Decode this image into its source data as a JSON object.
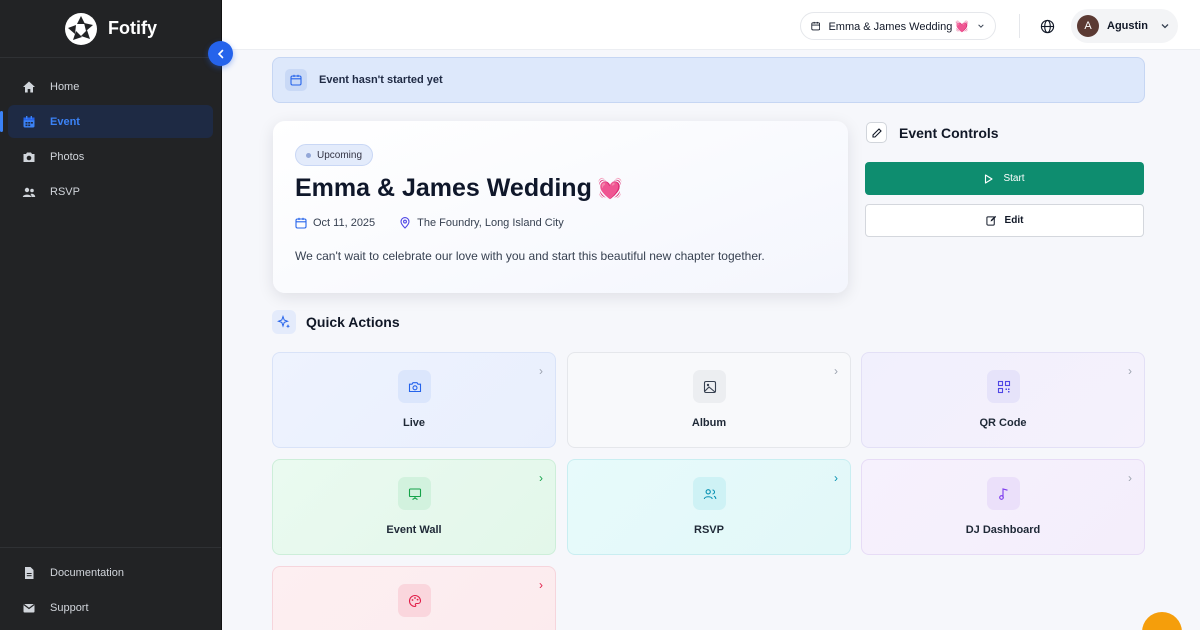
{
  "app": {
    "name": "Fotify"
  },
  "sidebar": {
    "items": [
      {
        "label": "Home",
        "icon": "home-icon"
      },
      {
        "label": "Event",
        "icon": "calendar-icon",
        "active": true
      },
      {
        "label": "Photos",
        "icon": "camera-icon"
      },
      {
        "label": "RSVP",
        "icon": "users-icon"
      }
    ],
    "bottom": [
      {
        "label": "Documentation",
        "icon": "document-icon"
      },
      {
        "label": "Support",
        "icon": "mail-icon"
      }
    ]
  },
  "header": {
    "event_selector": "Emma & James Wedding 💓",
    "user": {
      "initial": "A",
      "name": "Agustin"
    }
  },
  "banner": {
    "text": "Event hasn't started yet"
  },
  "event": {
    "status": "Upcoming",
    "title": "Emma & James Wedding",
    "emoji": "💓",
    "date": "Oct 11, 2025",
    "location": "The Foundry, Long Island City",
    "description": "We can't wait to celebrate our love with you and start this beautiful new chapter together."
  },
  "controls": {
    "title": "Event Controls",
    "start_label": "Start",
    "edit_label": "Edit"
  },
  "quick_actions": {
    "title": "Quick Actions",
    "tiles": [
      {
        "label": "Live",
        "icon": "camera-icon",
        "color": "#2563eb"
      },
      {
        "label": "Album",
        "icon": "image-icon",
        "color": "#374151"
      },
      {
        "label": "QR Code",
        "icon": "qr-code-icon",
        "color": "#4f46e5"
      },
      {
        "label": "Event Wall",
        "icon": "presentation-icon",
        "color": "#16a34a"
      },
      {
        "label": "RSVP",
        "icon": "users-icon",
        "color": "#0891b2"
      },
      {
        "label": "DJ Dashboard",
        "icon": "music-note-icon",
        "color": "#7c3aed"
      },
      {
        "label": "",
        "icon": "palette-icon",
        "color": "#e11d48"
      }
    ]
  },
  "colors": {
    "accent": "#2563eb",
    "start_button": "#0e8d6f",
    "sidebar_bg": "#222325"
  }
}
